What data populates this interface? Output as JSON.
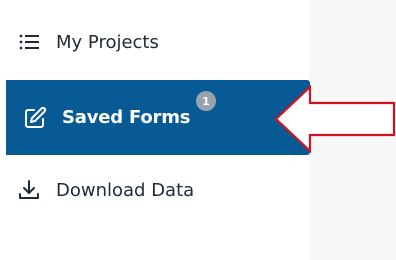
{
  "sidebar": {
    "items": [
      {
        "label": "My Projects",
        "icon": "list-icon"
      },
      {
        "label": "Saved Forms",
        "icon": "edit-form-icon",
        "badge": "1",
        "active": true
      },
      {
        "label": "Download Data",
        "icon": "download-icon"
      }
    ]
  },
  "colors": {
    "active_background": "#075a94",
    "badge": "#9aa3ad",
    "annotation_arrow_stroke": "#d3121f"
  }
}
